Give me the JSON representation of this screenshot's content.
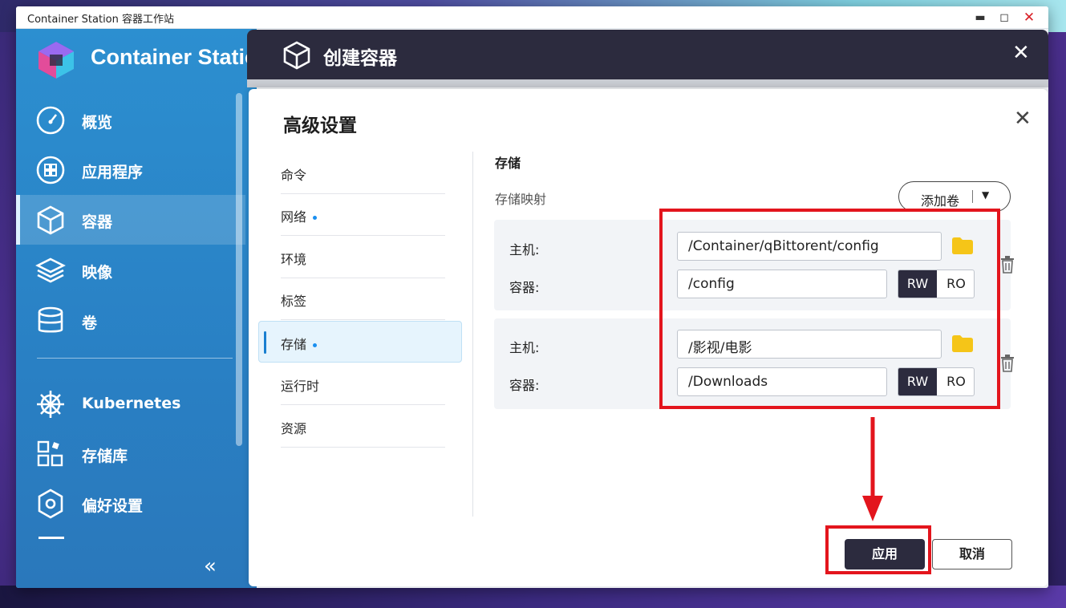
{
  "window": {
    "title": "Container Station 容器工作站",
    "controls": [
      "minimize",
      "maximize",
      "close"
    ]
  },
  "sidebar": {
    "app_name": "Container Station",
    "items": [
      {
        "label": "概览",
        "icon": "gauge-icon"
      },
      {
        "label": "应用程序",
        "icon": "apps-grid-icon"
      },
      {
        "label": "容器",
        "icon": "cube-icon",
        "active": true
      },
      {
        "label": "映像",
        "icon": "layers-icon"
      },
      {
        "label": "卷",
        "icon": "database-icon"
      },
      {
        "label": "Kubernetes",
        "icon": "helm-wheel-icon"
      },
      {
        "label": "存储库",
        "icon": "repository-icon"
      },
      {
        "label": "偏好设置",
        "icon": "gear-icon"
      }
    ],
    "collapse_label": "«"
  },
  "dialog": {
    "title": "创建容器",
    "close": "✕"
  },
  "panel": {
    "title": "高级设置",
    "close": "✕",
    "menu": [
      {
        "label": "命令",
        "dot": false
      },
      {
        "label": "网络",
        "dot": true
      },
      {
        "label": "环境",
        "dot": false
      },
      {
        "label": "标签",
        "dot": false
      },
      {
        "label": "存储",
        "dot": true,
        "selected": true
      },
      {
        "label": "运行时",
        "dot": false
      },
      {
        "label": "资源",
        "dot": false
      }
    ],
    "section_title": "存储",
    "section_subtitle": "存储映射",
    "add_volume": {
      "label": "添加卷",
      "caret": "▼"
    },
    "volumes": [
      {
        "host_label": "主机:",
        "host_value": "/Container/qBittorent/config",
        "container_label": "容器:",
        "container_value": "/config",
        "mode_rw": "RW",
        "mode_ro": "RO",
        "selected_mode": "RW"
      },
      {
        "host_label": "主机:",
        "host_value": "/影视/电影",
        "container_label": "容器:",
        "container_value": "/Downloads",
        "mode_rw": "RW",
        "mode_ro": "RO",
        "selected_mode": "RW"
      }
    ],
    "apply_label": "应用",
    "cancel_label": "取消"
  },
  "colors": {
    "sidebar": "#2a86c9",
    "dialog_header": "#2c2b3e",
    "annotation": "#e3151d",
    "folder": "#f5c518",
    "accent_dot": "#1a8ff0"
  }
}
